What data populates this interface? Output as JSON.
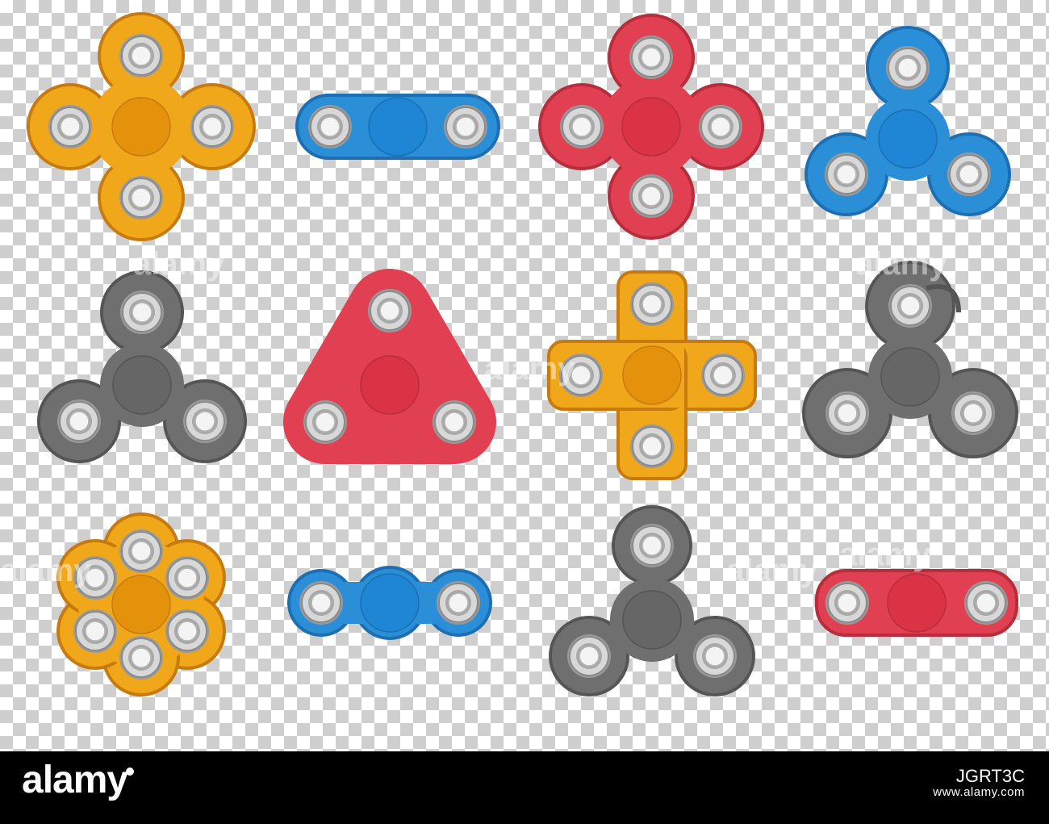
{
  "colors": {
    "orange": {
      "body": "#f0a81a",
      "hub": "#e4920c",
      "edge": "#c77b0e"
    },
    "blue": {
      "body": "#2b8fd8",
      "hub": "#1e86d4",
      "edge": "#1b6fb2"
    },
    "red": {
      "body": "#e04052",
      "hub": "#d93345",
      "edge": "#b82d3c"
    },
    "gray": {
      "body": "#6f6f6f",
      "hub": "#666666",
      "edge": "#555555"
    },
    "bearing_ring": "#d8d8d8",
    "bearing_inner": "#f4f4f4",
    "checker_dark": "#cfcfcf",
    "checker_light": "#ffffff",
    "footer_bg": "#000000"
  },
  "spinners": [
    {
      "name": "orange-quad-spinner",
      "color": "orange",
      "shape": "quad"
    },
    {
      "name": "blue-bar-spinner",
      "color": "blue",
      "shape": "bar"
    },
    {
      "name": "red-quad-spinner",
      "color": "red",
      "shape": "quad"
    },
    {
      "name": "blue-tri-spinner",
      "color": "blue",
      "shape": "tri"
    },
    {
      "name": "gray-tri-spinner",
      "color": "gray",
      "shape": "tri"
    },
    {
      "name": "red-rounded-triangle-spinner",
      "color": "red",
      "shape": "tri-fat"
    },
    {
      "name": "orange-cross-spinner",
      "color": "orange",
      "shape": "cross"
    },
    {
      "name": "gray-swirl-spinner",
      "color": "gray",
      "shape": "tri-swirl"
    },
    {
      "name": "orange-hexa-spinner",
      "color": "orange",
      "shape": "hexa"
    },
    {
      "name": "blue-bone-spinner",
      "color": "blue",
      "shape": "bone"
    },
    {
      "name": "gray-tri-spinner-2",
      "color": "gray",
      "shape": "tri"
    },
    {
      "name": "red-oval-bar-spinner",
      "color": "red",
      "shape": "oval-bar"
    }
  ],
  "watermark": {
    "text": "alamy"
  },
  "footer": {
    "logo_text": "alamy",
    "image_code": "JGRT3C",
    "domain": "www.alamy.com"
  }
}
